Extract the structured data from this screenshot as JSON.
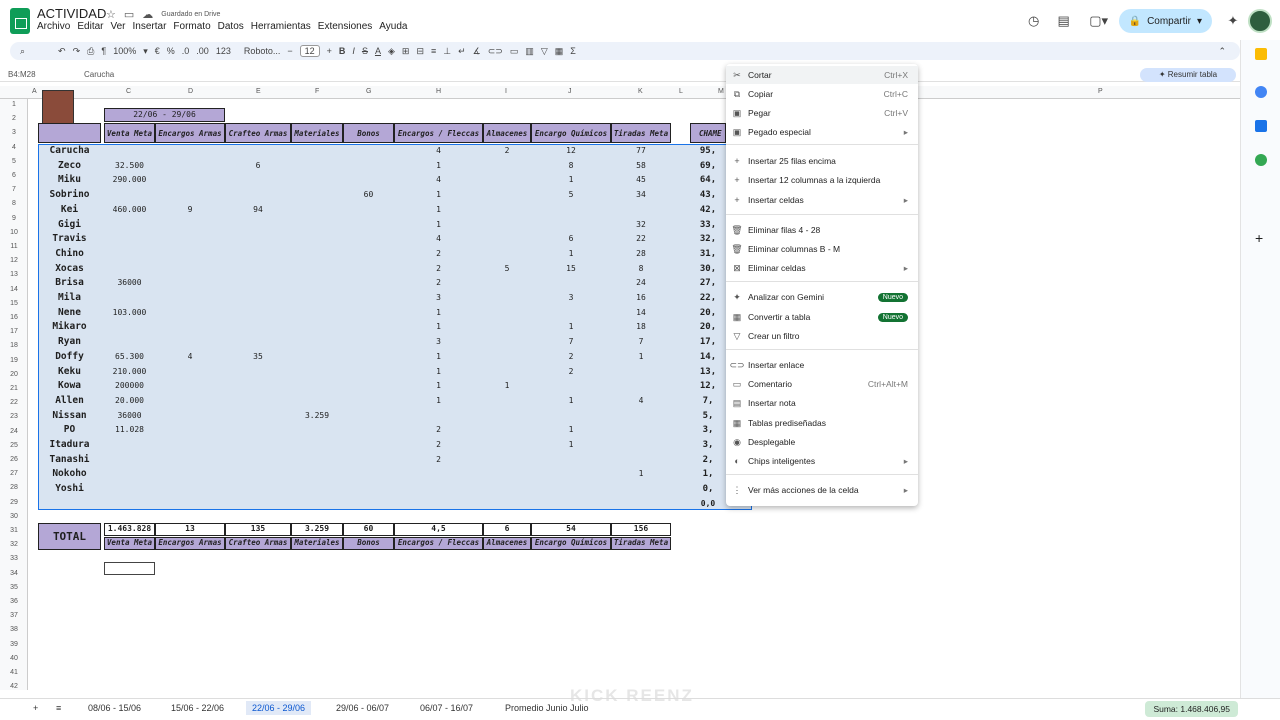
{
  "header": {
    "title": "ACTIVIDAD",
    "saved": "Guardado en Drive",
    "share": "Compartir"
  },
  "menu": [
    "Archivo",
    "Editar",
    "Ver",
    "Insertar",
    "Formato",
    "Datos",
    "Herramientas",
    "Extensiones",
    "Ayuda"
  ],
  "toolbar": {
    "zoom": "100%",
    "currency": "€",
    "percent": "%",
    "dec_minus": ".0",
    "dec_plus": ".00",
    "fmt": "123",
    "font": "Roboto...",
    "size": "12"
  },
  "formula": {
    "namebox": "B4:M28",
    "value": "Carucha"
  },
  "resumir": "Resumir tabla",
  "columns": [
    "C",
    "D",
    "E",
    "F",
    "G",
    "H",
    "I",
    "J",
    "K",
    "L",
    "M",
    "P"
  ],
  "rows": [
    "1",
    "2",
    "3",
    "4",
    "5",
    "6",
    "7",
    "8",
    "9",
    "10",
    "11",
    "12",
    "13",
    "14",
    "15",
    "16",
    "17",
    "18",
    "19",
    "20",
    "21",
    "22",
    "23",
    "24",
    "25",
    "26",
    "27",
    "28",
    "29",
    "30",
    "31",
    "32",
    "33",
    "34",
    "35",
    "36",
    "37",
    "38",
    "39",
    "40",
    "41",
    "42"
  ],
  "week": "22/06 - 29/06",
  "headers": [
    "Venta Meta",
    "Encargos Armas",
    "Crafteo Armas",
    "Materiales",
    "Bonos",
    "Encargos / Fleccas",
    "Almacenes",
    "Encargo Químicos",
    "Tiradas Meta"
  ],
  "cham": "CHAME",
  "names": [
    "Carucha",
    "Zeco",
    "Miku",
    "Sobrino",
    "Kei",
    "Gigi",
    "Travis",
    "Chino",
    "Xocas",
    "Brisa",
    "Mila",
    "Nene",
    "Mikaro",
    "Ryan",
    "Doffy",
    "Keku",
    "Kowa",
    "Allen",
    "Nissan",
    "PO",
    "Itadura",
    "Tanashi",
    "Nokoho",
    "Yoshi"
  ],
  "cells": [
    [
      "",
      "",
      "",
      "",
      "",
      "4",
      "2",
      "12",
      "77",
      "95,"
    ],
    [
      "32.500",
      "",
      "6",
      "",
      "",
      "1",
      "",
      "8",
      "58",
      "69,"
    ],
    [
      "290.000",
      "",
      "",
      "",
      "",
      "4",
      "",
      "1",
      "45",
      "64,"
    ],
    [
      "",
      "",
      "",
      "",
      "60",
      "1",
      "",
      "5",
      "34",
      "43,"
    ],
    [
      "460.000",
      "9",
      "94",
      "",
      "",
      "1",
      "",
      "",
      "",
      "42,"
    ],
    [
      "",
      "",
      "",
      "",
      "",
      "1",
      "",
      "",
      "32",
      "33,"
    ],
    [
      "",
      "",
      "",
      "",
      "",
      "4",
      "",
      "6",
      "22",
      "32,"
    ],
    [
      "",
      "",
      "",
      "",
      "",
      "2",
      "",
      "1",
      "28",
      "31,"
    ],
    [
      "",
      "",
      "",
      "",
      "",
      "2",
      "5",
      "15",
      "8",
      "30,"
    ],
    [
      "36000",
      "",
      "",
      "",
      "",
      "2",
      "",
      "",
      "24",
      "27,"
    ],
    [
      "",
      "",
      "",
      "",
      "",
      "3",
      "",
      "3",
      "16",
      "22,"
    ],
    [
      "103.000",
      "",
      "",
      "",
      "",
      "1",
      "",
      "",
      "14",
      "20,"
    ],
    [
      "",
      "",
      "",
      "",
      "",
      "1",
      "",
      "1",
      "18",
      "20,"
    ],
    [
      "",
      "",
      "",
      "",
      "",
      "3",
      "",
      "7",
      "7",
      "17,"
    ],
    [
      "65.300",
      "4",
      "35",
      "",
      "",
      "1",
      "",
      "2",
      "1",
      "14,"
    ],
    [
      "210.000",
      "",
      "",
      "",
      "",
      "1",
      "",
      "2",
      "",
      "13,"
    ],
    [
      "200000",
      "",
      "",
      "",
      "",
      "1",
      "1",
      "",
      "",
      "12,"
    ],
    [
      "20.000",
      "",
      "",
      "",
      "",
      "1",
      "",
      "1",
      "4",
      "7,"
    ],
    [
      "36000",
      "",
      "",
      "3.259",
      "",
      "",
      "",
      "",
      "",
      "5,"
    ],
    [
      "11.028",
      "",
      "",
      "",
      "",
      "2",
      "",
      "1",
      "",
      "3,"
    ],
    [
      "",
      "",
      "",
      "",
      "",
      "2",
      "",
      "1",
      "",
      "3,"
    ],
    [
      "",
      "",
      "",
      "",
      "",
      "2",
      "",
      "",
      "",
      "2,"
    ],
    [
      "",
      "",
      "",
      "",
      "",
      "",
      "",
      "",
      "1",
      "1,"
    ],
    [
      "",
      "",
      "",
      "",
      "",
      "",
      "",
      "",
      "",
      "0,"
    ],
    [
      "",
      "",
      "",
      "",
      "",
      "",
      "",
      "",
      "",
      "0,0"
    ]
  ],
  "total": {
    "label": "TOTAL",
    "values": [
      "1.463.828",
      "13",
      "135",
      "3.259",
      "60",
      "4,5",
      "6",
      "54",
      "156"
    ]
  },
  "context_menu": [
    {
      "label": "Cortar",
      "shortcut": "Ctrl+X",
      "icon": "cut-icon"
    },
    {
      "label": "Copiar",
      "shortcut": "Ctrl+C",
      "icon": "copy-icon"
    },
    {
      "label": "Pegar",
      "shortcut": "Ctrl+V",
      "icon": "paste-icon"
    },
    {
      "label": "Pegado especial",
      "submenu": true,
      "icon": "paste-special-icon"
    },
    {
      "label": "Insertar 25 filas encima",
      "icon": "plus-icon"
    },
    {
      "label": "Insertar 12 columnas a la izquierda",
      "icon": "plus-icon"
    },
    {
      "label": "Insertar celdas",
      "submenu": true,
      "icon": "plus-icon"
    },
    {
      "label": "Eliminar filas 4 - 28",
      "icon": "trash-icon"
    },
    {
      "label": "Eliminar columnas B - M",
      "icon": "trash-icon"
    },
    {
      "label": "Eliminar celdas",
      "submenu": true,
      "icon": "x-icon"
    },
    {
      "label": "Analizar con Gemini",
      "badge": "Nuevo",
      "icon": "gemini-icon"
    },
    {
      "label": "Convertir a tabla",
      "badge": "Nuevo",
      "icon": "table-icon"
    },
    {
      "label": "Crear un filtro",
      "icon": "filter-icon"
    },
    {
      "label": "Insertar enlace",
      "icon": "link-icon"
    },
    {
      "label": "Comentario",
      "shortcut": "Ctrl+Alt+M",
      "icon": "comment-icon"
    },
    {
      "label": "Insertar nota",
      "icon": "note-icon"
    },
    {
      "label": "Tablas prediseñadas",
      "icon": "table-icon"
    },
    {
      "label": "Desplegable",
      "icon": "dropdown-icon"
    },
    {
      "label": "Chips inteligentes",
      "submenu": true,
      "icon": "chip-icon"
    },
    {
      "label": "Ver más acciones de la celda",
      "submenu": true,
      "icon": "more-icon"
    }
  ],
  "sheets": [
    "08/06 - 15/06",
    "15/06 - 22/06",
    "22/06 - 29/06",
    "29/06 - 06/07",
    "06/07 - 16/07",
    "Promedio Junio Julio"
  ],
  "suma": "Suma: 1.468.406,95",
  "watermark": "KICK REENZ"
}
